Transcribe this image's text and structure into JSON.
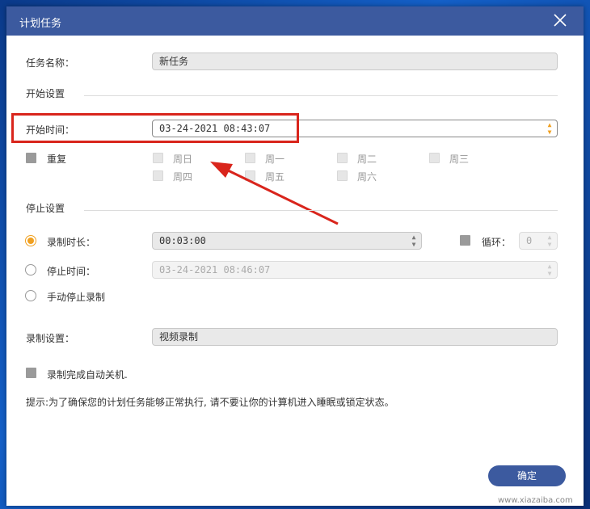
{
  "dialog": {
    "title": "计划任务",
    "task_name_label": "任务名称：",
    "task_name_value": "新任务",
    "start_section": "开始设置",
    "start_time_label": "开始时间：",
    "start_time_value": "03-24-2021 08:43:07",
    "repeat_label": "重复",
    "weekdays": [
      "周日",
      "周一",
      "周二",
      "周三",
      "周四",
      "周五",
      "周六"
    ],
    "stop_section": "停止设置",
    "duration_label": "录制时长：",
    "duration_value": "00:03:00",
    "loop_label": "循环：",
    "loop_value": "0",
    "stop_time_label": "停止时间：",
    "stop_time_value": "03-24-2021 08:46:07",
    "manual_stop_label": "手动停止录制",
    "record_settings_label": "录制设置：",
    "record_settings_value": "视频录制",
    "auto_shutdown_label": "录制完成自动关机.",
    "tip": "提示:为了确保您的计划任务能够正常执行, 请不要让你的计算机进入睡眠或锁定状态。",
    "ok_button": "确定"
  },
  "watermark": "www.xiazaiba.com",
  "colors": {
    "titlebar": "#3c5a9f",
    "accent_orange": "#f0a020",
    "annotation_red": "#d9251c"
  }
}
